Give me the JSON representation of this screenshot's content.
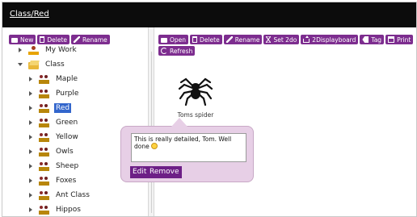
{
  "breadcrumb": {
    "part1": "Class",
    "separator": "/",
    "part2": "Red"
  },
  "left_toolbar": [
    {
      "label": "New",
      "icon": "folder-icon"
    },
    {
      "label": "Delete",
      "icon": "bin-icon"
    },
    {
      "label": "Rename",
      "icon": "pencil-icon"
    }
  ],
  "right_toolbar": [
    {
      "label": "Open",
      "icon": "folder-icon"
    },
    {
      "label": "Delete",
      "icon": "bin-icon"
    },
    {
      "label": "Rename",
      "icon": "pencil-icon"
    },
    {
      "label": "Set 2do",
      "icon": "hourglass-icon"
    },
    {
      "label": "2Displayboard",
      "icon": "upload-icon"
    },
    {
      "label": "Tag",
      "icon": "tag-icon"
    },
    {
      "label": "Print",
      "icon": "printer-icon"
    }
  ],
  "refresh_label": "Refresh",
  "tree": [
    {
      "label": "My Work",
      "toggle": "collapsed",
      "icon": "person-icon",
      "indent": 0
    },
    {
      "label": "Class",
      "toggle": "expanded",
      "icon": "open-folder-icon",
      "indent": 0
    },
    {
      "label": "Maple",
      "toggle": "collapsed",
      "icon": "group-icon",
      "indent": 1
    },
    {
      "label": "Purple",
      "toggle": "collapsed",
      "icon": "group-icon",
      "indent": 1
    },
    {
      "label": "Red",
      "toggle": "collapsed",
      "icon": "group-icon",
      "indent": 1,
      "selected": true
    },
    {
      "label": "Green",
      "toggle": "collapsed",
      "icon": "group-icon",
      "indent": 1
    },
    {
      "label": "Yellow",
      "toggle": "collapsed",
      "icon": "group-icon",
      "indent": 1
    },
    {
      "label": "Owls",
      "toggle": "collapsed",
      "icon": "group-icon",
      "indent": 1
    },
    {
      "label": "Sheep",
      "toggle": "collapsed",
      "icon": "group-icon",
      "indent": 1
    },
    {
      "label": "Foxes",
      "toggle": "collapsed",
      "icon": "group-icon",
      "indent": 1
    },
    {
      "label": "Ant Class",
      "toggle": "collapsed",
      "icon": "group-icon",
      "indent": 1
    },
    {
      "label": "Hippos",
      "toggle": "collapsed",
      "icon": "group-icon",
      "indent": 1
    }
  ],
  "file": {
    "name": "Toms spider",
    "icon": "spider-icon"
  },
  "comment": {
    "text": "This is really detailed, Tom. Well done",
    "edit_label": "Edit",
    "remove_label": "Remove"
  },
  "colors": {
    "accent": "#7d2d8f",
    "title_bar": "#0c0c0c",
    "selection": "#3366cc",
    "popup_bg": "#e7cfe6"
  }
}
